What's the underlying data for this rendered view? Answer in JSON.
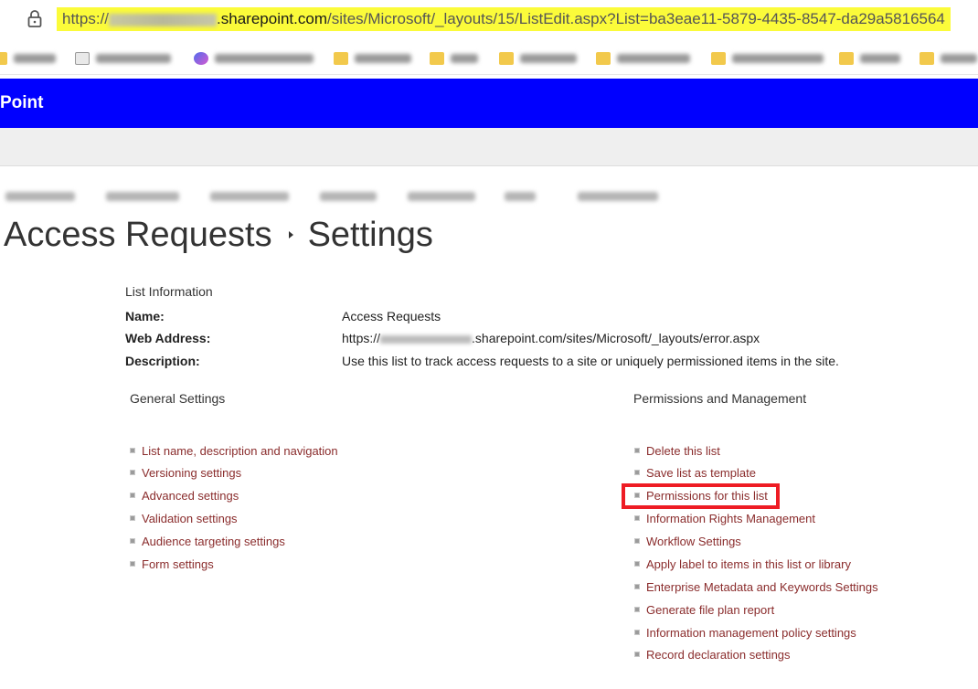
{
  "browser": {
    "url_prefix": "https://",
    "url_domain": ".sharepoint.com",
    "url_path": "/sites/Microsoft/_layouts/15/ListEdit.aspx?List=ba3eae11-5879-4435-8547-da29a5816564"
  },
  "suite": {
    "title": "Point"
  },
  "page": {
    "title_parent": "Access Requests",
    "title_current": "Settings"
  },
  "list_info": {
    "heading": "List Information",
    "name_label": "Name:",
    "name_value": "Access Requests",
    "web_label": "Web Address:",
    "web_prefix": "https://",
    "web_suffix": ".sharepoint.com/sites/Microsoft/_layouts/error.aspx",
    "desc_label": "Description:",
    "desc_value": "Use this list to track access requests to a site or uniquely permissioned items in the site."
  },
  "general": {
    "heading": "General Settings",
    "links": [
      "List name, description and navigation",
      "Versioning settings",
      "Advanced settings",
      "Validation settings",
      "Audience targeting settings",
      "Form settings"
    ]
  },
  "permissions": {
    "heading": "Permissions and Management",
    "links": [
      "Delete this list",
      "Save list as template",
      "Permissions for this list",
      "Information Rights Management",
      "Workflow Settings",
      "Apply label to items in this list or library",
      "Enterprise Metadata and Keywords Settings",
      "Generate file plan report",
      "Information management policy settings",
      "Record declaration settings"
    ]
  },
  "colors": {
    "suite_bar": "#0000ff",
    "link": "#8a2c2c",
    "highlight": "#ee1c24",
    "url_highlight": "#fbfb3a"
  }
}
